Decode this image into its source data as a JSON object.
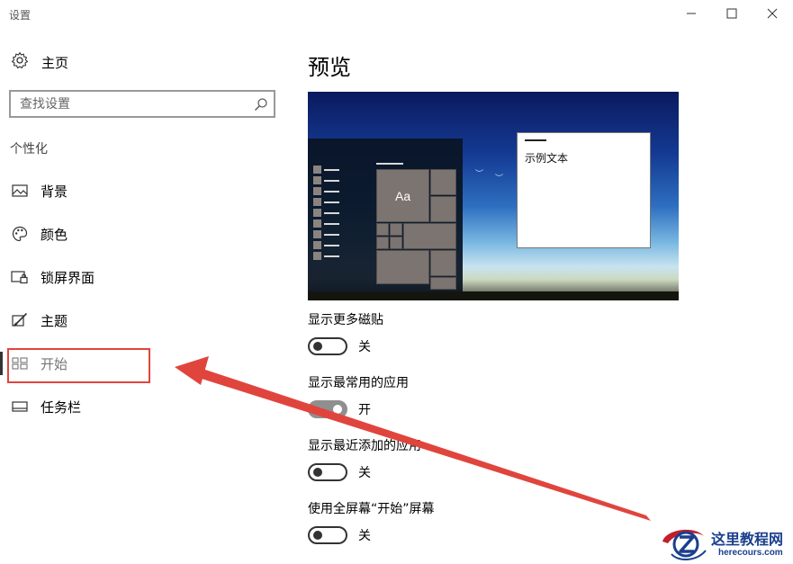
{
  "window": {
    "title": "设置",
    "controls": [
      "minimize-icon",
      "maximize-icon",
      "close-icon"
    ]
  },
  "sidebar": {
    "home_label": "主页",
    "home_icon": "gear-icon",
    "search_placeholder": "查找设置",
    "search_value": "",
    "section_label": "个性化",
    "items": [
      {
        "label": "背景",
        "icon": "picture-icon",
        "active": false
      },
      {
        "label": "颜色",
        "icon": "palette-icon",
        "active": false
      },
      {
        "label": "锁屏界面",
        "icon": "lock-screen-icon",
        "active": false
      },
      {
        "label": "主题",
        "icon": "theme-brush-icon",
        "active": false
      },
      {
        "label": "开始",
        "icon": "start-tiles-icon",
        "active": true
      },
      {
        "label": "任务栏",
        "icon": "taskbar-icon",
        "active": false
      }
    ]
  },
  "main": {
    "title": "预览",
    "preview": {
      "tile_label": "Aa",
      "sample_text": "示例文本"
    },
    "settings": [
      {
        "title": "显示更多磁贴",
        "state": "关",
        "on": false
      },
      {
        "title": "显示最常用的应用",
        "state": "开",
        "on": true
      },
      {
        "title": "显示最近添加的应用",
        "state": "关",
        "on": false
      },
      {
        "title": "使用全屏幕“开始”屏幕",
        "state": "关",
        "on": false
      }
    ]
  },
  "annotation": {
    "highlight_color": "#e0453d",
    "arrow_color": "#e0453d"
  },
  "watermark": {
    "name": "这里教程网",
    "url": "herecours.com"
  },
  "colors": {
    "accent_dark": "#333333",
    "toggle_on": "#8f8f8f"
  }
}
